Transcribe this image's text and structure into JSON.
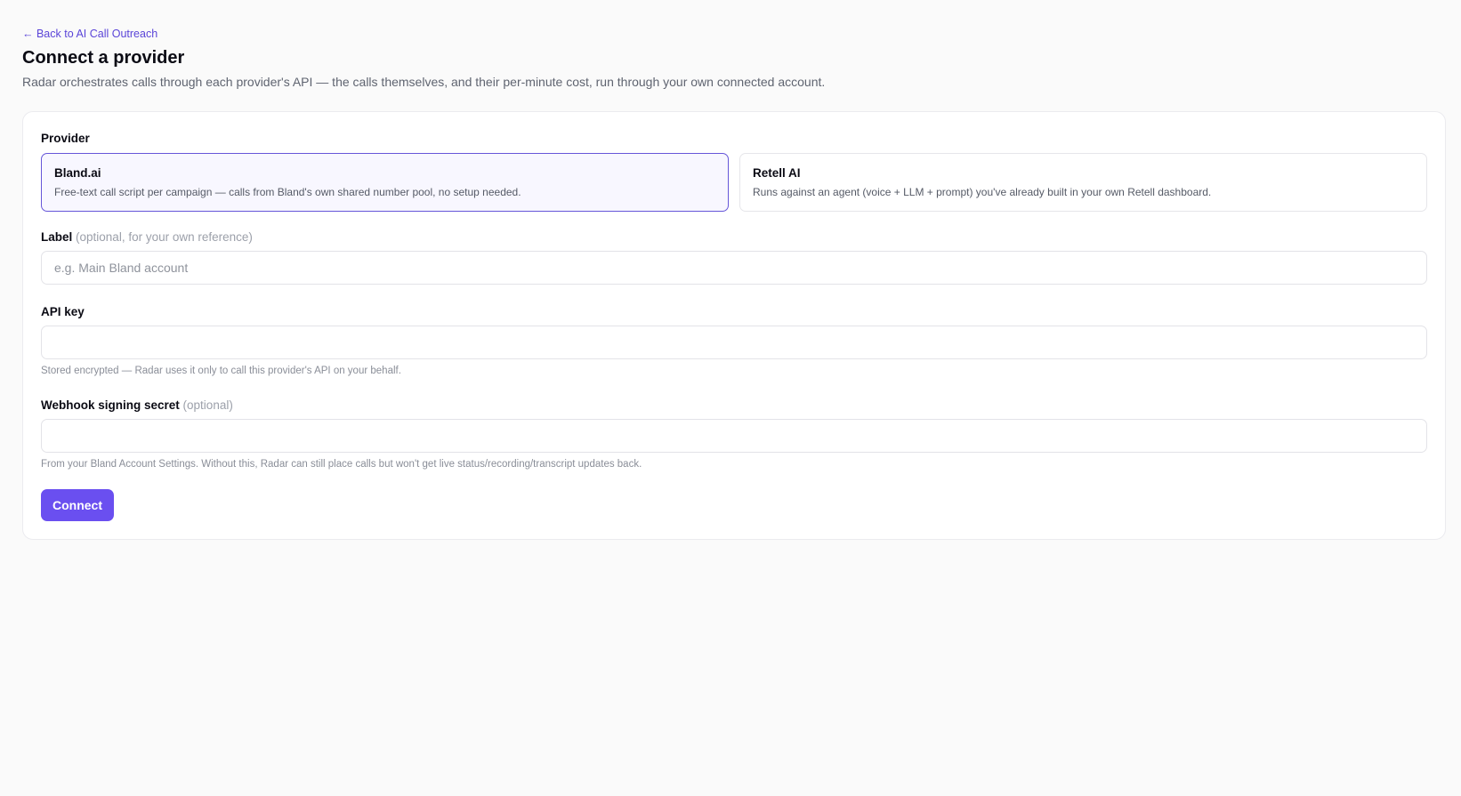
{
  "nav": {
    "back_label": "← Back to AI Call Outreach"
  },
  "header": {
    "title": "Connect a provider",
    "subtitle": "Radar orchestrates calls through each provider's API — the calls themselves, and their per-minute cost, run through your own connected account."
  },
  "form": {
    "provider": {
      "label": "Provider",
      "selected": "Bland.ai",
      "options": [
        {
          "name": "Bland.ai",
          "description": "Free-text call script per campaign — calls from Bland's own shared number pool, no setup needed."
        },
        {
          "name": "Retell AI",
          "description": "Runs against an agent (voice + LLM + prompt) you've already built in your own Retell dashboard."
        }
      ]
    },
    "label_field": {
      "label": "Label",
      "optional_note": "(optional, for your own reference)",
      "placeholder": "e.g. Main Bland account",
      "value": ""
    },
    "api_key_field": {
      "label": "API key",
      "value": "",
      "help": "Stored encrypted — Radar uses it only to call this provider's API on your behalf."
    },
    "webhook_field": {
      "label": "Webhook signing secret",
      "optional_note": "(optional)",
      "value": "",
      "help": "From your Bland Account Settings. Without this, Radar can still place calls but won't get live status/recording/transcript updates back."
    },
    "submit_label": "Connect"
  },
  "colors": {
    "accent": "#6a4ff0",
    "link": "#5b45d8",
    "selected_border": "#6656d9",
    "background": "#fafafa"
  }
}
